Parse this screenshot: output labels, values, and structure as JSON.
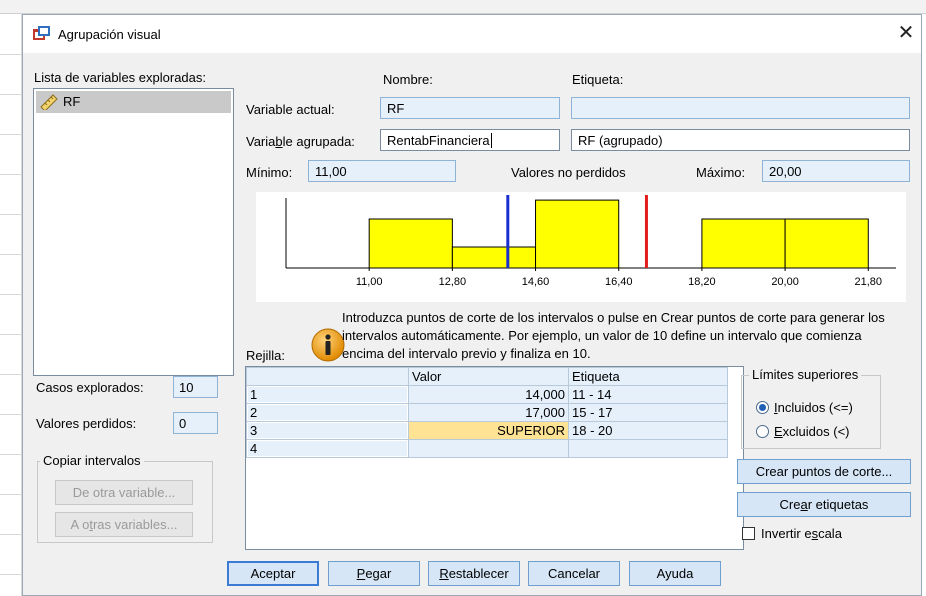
{
  "dialog": {
    "title": "Agrupación visual"
  },
  "variables": {
    "list_label": "Lista de variables exploradas:",
    "items": [
      {
        "name": "RF",
        "icon": "scale-ruler-icon"
      }
    ]
  },
  "headers": {
    "name": "Nombre:",
    "label": "Etiqueta:"
  },
  "current_variable": {
    "label": "Variable actual:",
    "name": "RF",
    "tag": ""
  },
  "grouped_variable": {
    "label_pre": "Varia",
    "label_mnemonic": "b",
    "label_post": "le agrupada:",
    "name": "RentabFinanciera",
    "tag": "RF (agrupado)"
  },
  "range": {
    "min_label": "Mínimo:",
    "min_value": "11,00",
    "nonmissing_label": "Valores no perdidos",
    "max_label": "Máximo:",
    "max_value": "20,00"
  },
  "histogram": {
    "x_ticks": [
      "11,00",
      "12,80",
      "14,60",
      "16,40",
      "18,20",
      "20,00",
      "21,80"
    ],
    "x_min": 9.2,
    "x_max": 22.4,
    "bars": [
      {
        "from": 11.0,
        "to": 12.8,
        "height": 0.7
      },
      {
        "from": 12.8,
        "to": 14.6,
        "height": 0.3
      },
      {
        "from": 14.6,
        "to": 16.4,
        "height": 0.97
      },
      {
        "from": 18.2,
        "to": 20.0,
        "height": 0.7
      },
      {
        "from": 20.0,
        "to": 21.8,
        "height": 0.7
      }
    ],
    "cutpoints": [
      {
        "value": 14.0,
        "color": "#1a2fd0"
      },
      {
        "value": 17.0,
        "color": "#e21b1b"
      }
    ],
    "bar_color": "#ffff00"
  },
  "info_text": "Introduzca puntos de corte de los intervalos o pulse en Crear puntos de corte para generar los intervalos automáticamente. Por ejemplo, un valor de 10 define un intervalo que comienza encima del intervalo previo y finaliza en 10.",
  "grid": {
    "label": "Rejilla:",
    "columns": [
      "",
      "Valor",
      "Etiqueta"
    ],
    "rows": [
      {
        "num": "1",
        "value": "14,000",
        "label": "11 - 14"
      },
      {
        "num": "2",
        "value": "17,000",
        "label": "15 - 17"
      },
      {
        "num": "3",
        "value": "SUPERIOR",
        "label": "18 - 20"
      },
      {
        "num": "4",
        "value": "",
        "label": ""
      }
    ]
  },
  "stats": {
    "cases_label": "Casos explorados:",
    "cases_value": "10",
    "missing_label": "Valores perdidos:",
    "missing_value": "0"
  },
  "copy": {
    "title": "Copiar intervalos",
    "from_other": "De otra variable...",
    "to_other_pre": "A o",
    "to_other_mnemonic": "t",
    "to_other_post": "ras variables..."
  },
  "upper_limits": {
    "title": "Límites superiores",
    "included_mnemonic": "I",
    "included_post": "ncluidos (<=)",
    "excluded_mnemonic": "E",
    "excluded_post": "xcluidos (<)"
  },
  "actions": {
    "make_cutpoints": "Crear puntos de corte...",
    "make_labels_pre": "Cre",
    "make_labels_mnemonic": "a",
    "make_labels_post": "r etiquetas",
    "invert_pre": "Invertir e",
    "invert_mnemonic": "s",
    "invert_post": "cala"
  },
  "footer": {
    "ok": "Aceptar",
    "paste_mnemonic": "P",
    "paste_post": "egar",
    "reset_mnemonic": "R",
    "reset_post": "establecer",
    "cancel": "Cancelar",
    "help": "Ayuda"
  },
  "colors": {
    "dialog_bg": "#f0f0f0",
    "readonly_field": "#e5f0fb",
    "selected_cell": "#ffe394",
    "accent": "#3b7bd4"
  }
}
